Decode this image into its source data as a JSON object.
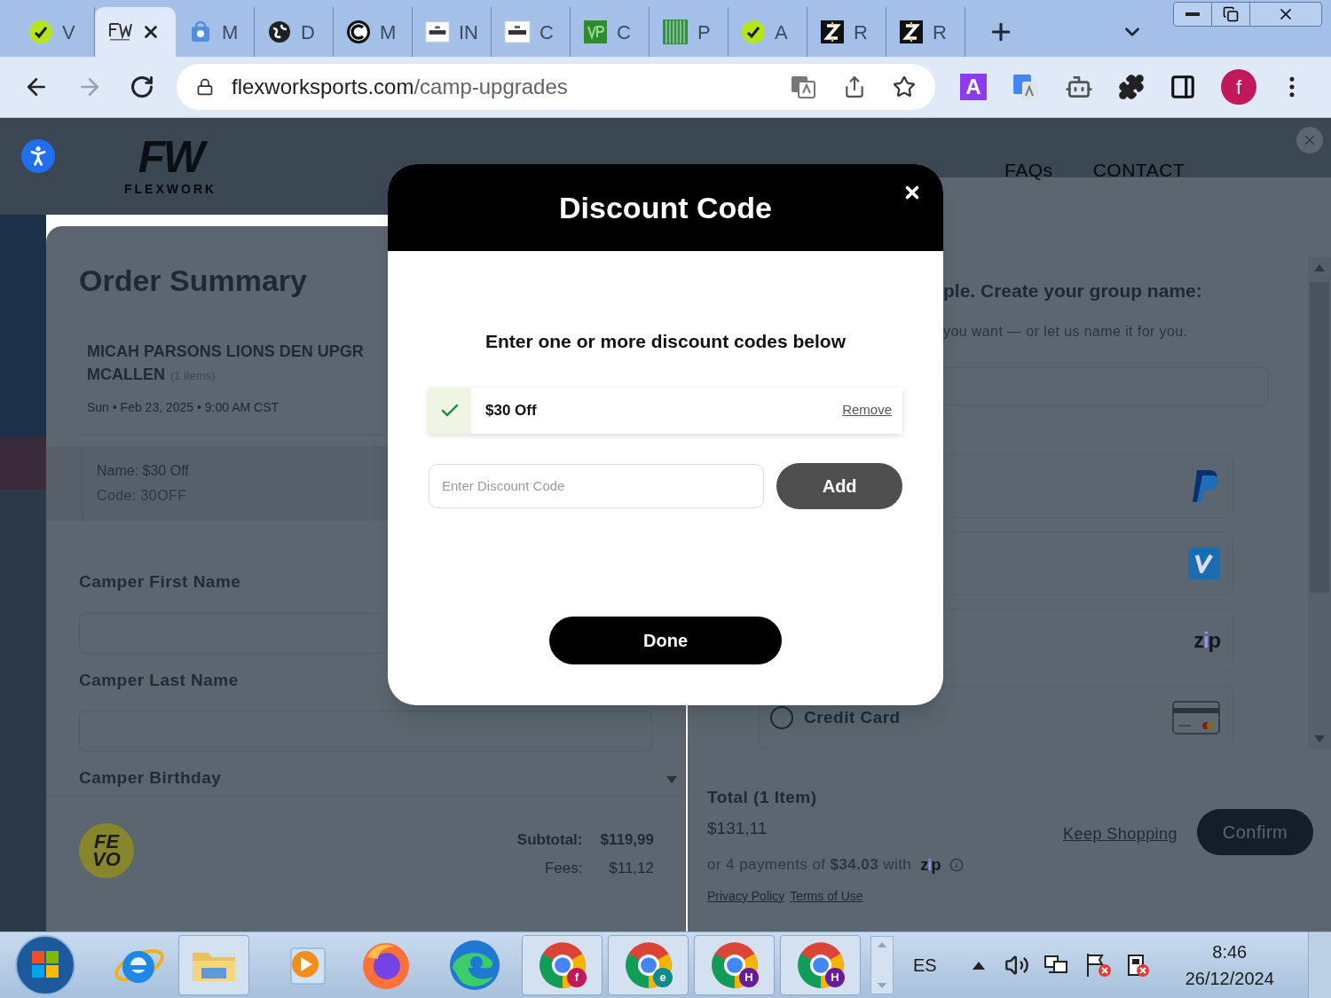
{
  "browser": {
    "tabs": [
      {
        "kind": "lime",
        "title": "V",
        "selected": false
      },
      {
        "kind": "fw",
        "selected": true
      },
      {
        "kind": "bag",
        "title": "M",
        "selected": false
      },
      {
        "kind": "globe",
        "title": "D",
        "selected": false
      },
      {
        "kind": "ring",
        "title": "M",
        "selected": false
      },
      {
        "kind": "inucat",
        "title": "IN",
        "selected": false
      },
      {
        "kind": "inucat",
        "title": "C",
        "selected": false
      },
      {
        "kind": "vp",
        "title": "C",
        "selected": false
      },
      {
        "kind": "lines",
        "title": "P",
        "selected": false
      },
      {
        "kind": "lime",
        "title": "A",
        "selected": false
      },
      {
        "kind": "z",
        "title": "R",
        "selected": false
      },
      {
        "kind": "z",
        "title": "R",
        "selected": false
      }
    ],
    "domain": "flexworksports.com",
    "path": "/camp-upgrades",
    "extension": "A",
    "avatar": "f"
  },
  "site": {
    "logo_mark": "FW",
    "logo_name": "FLEXWORK",
    "nav": [
      "FAQs",
      "CONTACT"
    ]
  },
  "order_summary": {
    "title": "Order Summary",
    "item_title": "MICAH PARSONS LIONS DEN UPGR",
    "item_subtitle": "MCALLEN",
    "item_count": "(1 items)",
    "date": "Sun • Feb 23, 2025 • 9:00 AM CST",
    "discount_name": "Name: $30 Off",
    "discount_code": "Code: 30OFF",
    "fields": [
      {
        "label": "Camper First Name"
      },
      {
        "label": "Camper Last Name"
      }
    ],
    "birthday_label": "Camper Birthday",
    "sponsor_logo": [
      "FE",
      "VO"
    ],
    "subtotal_label": "Subtotal:",
    "subtotal": "$119,99",
    "fees_label": "Fees:",
    "fees": "$11,12"
  },
  "group": {
    "heading": "ple. Create your group name:",
    "hint": "you want — or let us name it for you."
  },
  "payment_options": [
    {
      "kind": "paypal"
    },
    {
      "kind": "venmo"
    },
    {
      "kind": "zip",
      "logo": "zip"
    },
    {
      "kind": "card",
      "label": "Credit Card",
      "checked": false
    }
  ],
  "checkout": {
    "total_label": "Total (1 Item)",
    "total": "$131,11",
    "installments": "or 4 payments of **$34.03** with",
    "zip_logo": "zip",
    "links": [
      "Privacy Policy",
      "Terms of Use"
    ],
    "keep_shopping": "Keep Shopping",
    "confirm": "Confirm"
  },
  "modal": {
    "title": "Discount Code",
    "instruction": "Enter one or more discount codes below",
    "applied_codes": [
      {
        "label": "$30 Off",
        "action": "Remove"
      }
    ],
    "placeholder": "Enter Discount Code",
    "add": "Add",
    "done": "Done"
  },
  "taskbar": {
    "apps": [
      {
        "kind": "ie"
      },
      {
        "kind": "folder"
      },
      {
        "kind": "media"
      },
      {
        "kind": "firefox"
      },
      {
        "kind": "edge"
      },
      {
        "kind": "chrome",
        "badge": "f",
        "color": "#c2185b"
      },
      {
        "kind": "chrome",
        "badge": "e",
        "color": "#0f8a8a"
      },
      {
        "kind": "chrome",
        "badge": "H",
        "color": "#6a1b9a"
      },
      {
        "kind": "chrome",
        "badge": "H",
        "color": "#6a1b9a"
      }
    ],
    "language": "ES",
    "time": "8:46",
    "date": "26/12/2024"
  }
}
